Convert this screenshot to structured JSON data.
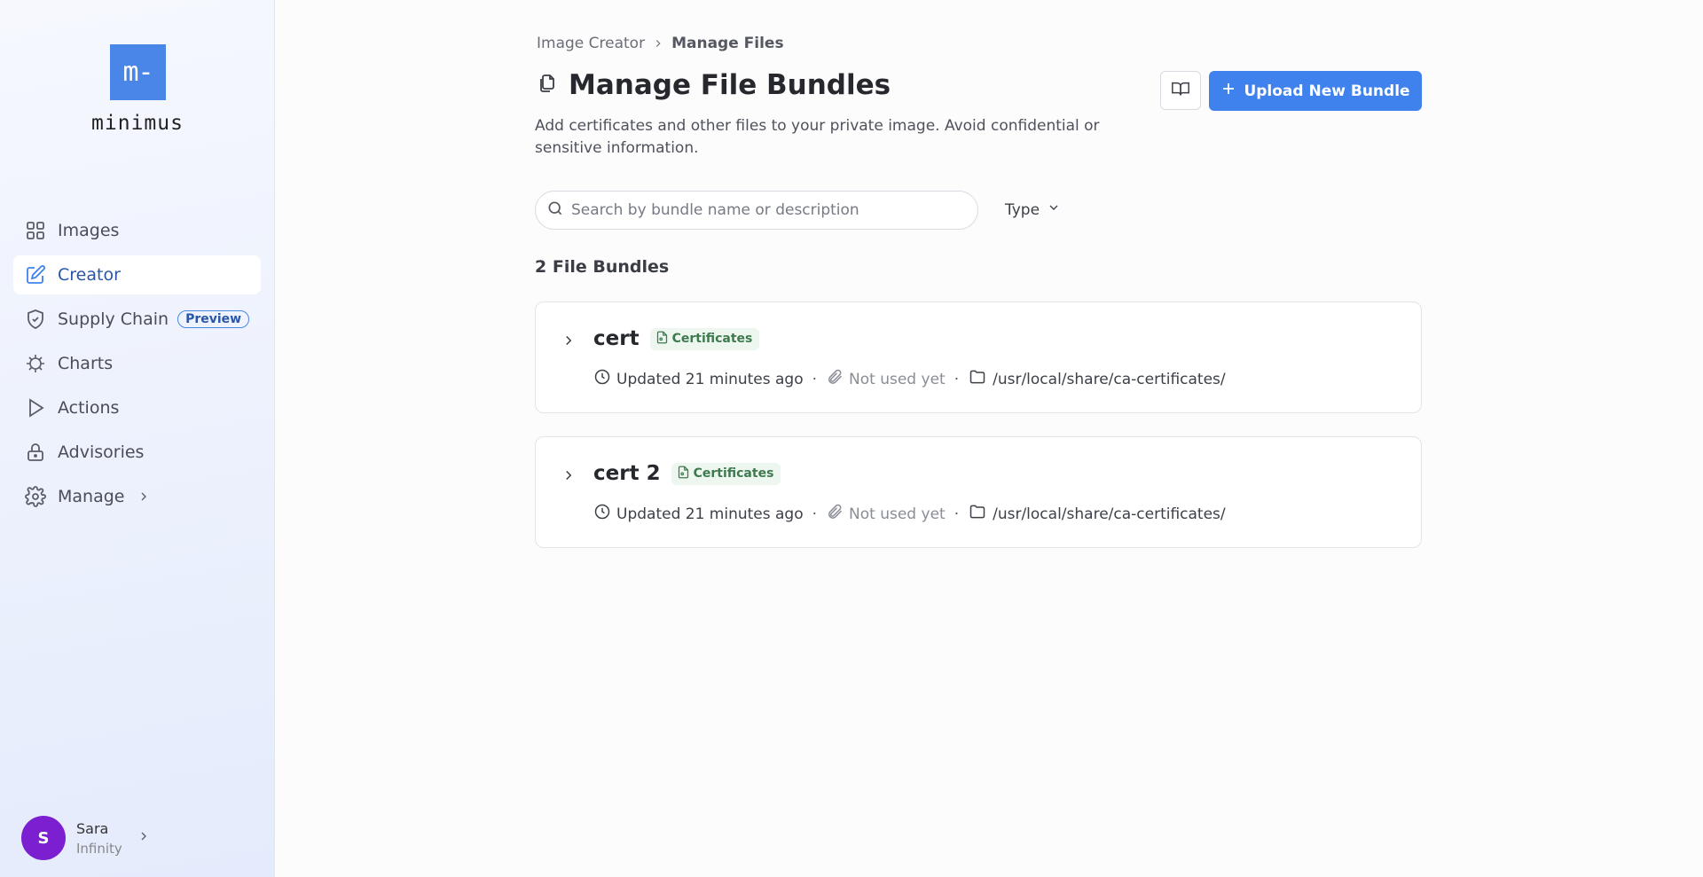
{
  "sidebar": {
    "logo_mark": "m-",
    "brand": "minimus",
    "items": [
      {
        "label": "Images",
        "icon": "grid-icon"
      },
      {
        "label": "Creator",
        "icon": "edit-icon",
        "active": true
      },
      {
        "label": "Supply Chain",
        "icon": "shield-icon",
        "badge": "Preview"
      },
      {
        "label": "Charts",
        "icon": "helm-icon"
      },
      {
        "label": "Actions",
        "icon": "play-icon"
      },
      {
        "label": "Advisories",
        "icon": "lock-icon"
      },
      {
        "label": "Manage",
        "icon": "gear-icon"
      }
    ],
    "user": {
      "initial": "S",
      "name": "Sara",
      "org": "Infinity"
    }
  },
  "breadcrumb": {
    "parent": "Image Creator",
    "current": "Manage Files"
  },
  "page": {
    "title": "Manage File Bundles",
    "description": "Add certificates and other files to your private image. Avoid confidential or sensitive information.",
    "upload_label": "Upload New Bundle"
  },
  "search": {
    "placeholder": "Search by bundle name or description",
    "value": ""
  },
  "filter": {
    "type_label": "Type"
  },
  "count_label": "2 File Bundles",
  "bundles": [
    {
      "name": "cert",
      "tag": "Certificates",
      "updated": "Updated 21 minutes ago",
      "usage": "Not used yet",
      "path": "/usr/local/share/ca-certificates/"
    },
    {
      "name": "cert 2",
      "tag": "Certificates",
      "updated": "Updated 21 minutes ago",
      "usage": "Not used yet",
      "path": "/usr/local/share/ca-certificates/"
    }
  ],
  "colors": {
    "accent": "#3f82ee",
    "tag_bg": "#edf6ef",
    "tag_text": "#3f7a4f",
    "avatar": "#7b1fd1"
  }
}
